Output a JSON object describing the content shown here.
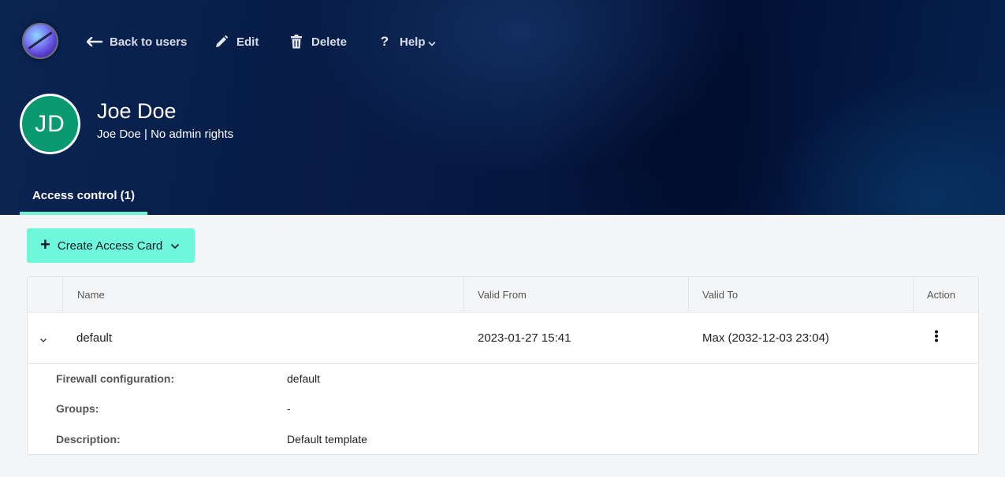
{
  "header": {
    "nav": {
      "back_label": "Back to users",
      "edit_label": "Edit",
      "delete_label": "Delete",
      "help_label": "Help"
    }
  },
  "user": {
    "initials": "JD",
    "name": "Joe Doe",
    "subtitle": "Joe Doe | No admin rights",
    "avatar_color": "#0a9a72"
  },
  "tabs": [
    {
      "label": "Access control (1)",
      "active": true
    }
  ],
  "actions": {
    "create_label": "Create Access Card",
    "accent_color": "#6ff7da"
  },
  "table": {
    "columns": [
      "Name",
      "Valid From",
      "Valid To",
      "Action"
    ],
    "rows": [
      {
        "name": "default",
        "valid_from": "2023-01-27 15:41",
        "valid_to": "Max (2032-12-03 23:04)",
        "expanded": true,
        "details": [
          {
            "label": "Firewall configuration:",
            "value": "default"
          },
          {
            "label": "Groups:",
            "value": "-"
          },
          {
            "label": "Description:",
            "value": "Default template"
          }
        ]
      }
    ]
  },
  "icons": {
    "logo": "app-logo",
    "back": "arrow-left-icon",
    "edit": "pencil-icon",
    "delete": "trash-icon",
    "help": "question-icon",
    "create": "plus-icon",
    "row_expand": "chevron-down-icon",
    "row_action": "kebab-menu-icon"
  }
}
